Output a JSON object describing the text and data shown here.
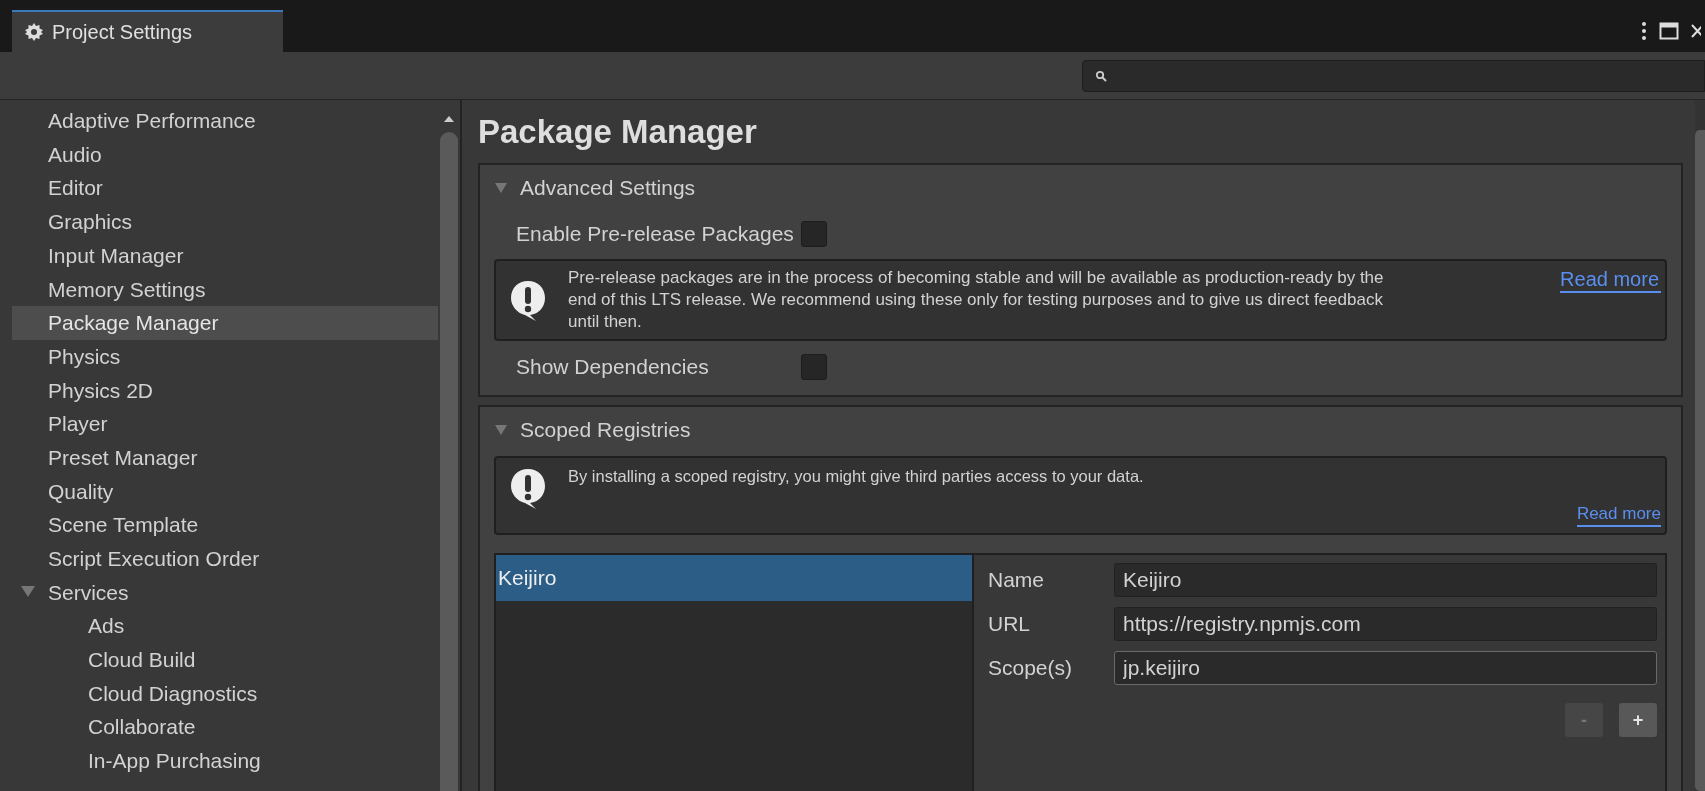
{
  "window": {
    "tab": {
      "title": "Project Settings",
      "selected": true
    }
  },
  "sidebar": {
    "items": [
      {
        "label": "Adaptive Performance",
        "selected": false
      },
      {
        "label": "Audio",
        "selected": false
      },
      {
        "label": "Editor",
        "selected": false
      },
      {
        "label": "Graphics",
        "selected": false
      },
      {
        "label": "Input Manager",
        "selected": false
      },
      {
        "label": "Memory Settings",
        "selected": false
      },
      {
        "label": "Package Manager",
        "selected": true
      },
      {
        "label": "Physics",
        "selected": false
      },
      {
        "label": "Physics 2D",
        "selected": false
      },
      {
        "label": "Player",
        "selected": false
      },
      {
        "label": "Preset Manager",
        "selected": false
      },
      {
        "label": "Quality",
        "selected": false
      },
      {
        "label": "Scene Template",
        "selected": false
      },
      {
        "label": "Script Execution Order",
        "selected": false
      },
      {
        "label": "Services",
        "selected": false,
        "expanded": true,
        "children": [
          {
            "label": "Ads",
            "selected": false
          },
          {
            "label": "Cloud Build",
            "selected": false
          },
          {
            "label": "Cloud Diagnostics",
            "selected": false
          },
          {
            "label": "Collaborate",
            "selected": false
          },
          {
            "label": "In-App Purchasing",
            "selected": false
          }
        ]
      }
    ]
  },
  "content": {
    "title": "Package Manager",
    "sections": [
      {
        "title": "Advanced Settings",
        "expanded": true,
        "rows": [
          {
            "kind": "checkbox",
            "label": "Enable Pre-release Packages",
            "checked": false
          },
          {
            "kind": "help",
            "text": "Pre-release packages are in the process of becoming stable and will be available as production-ready by the end of this LTS release. We recommend using these only for testing purposes and to give us direct feedback until then.",
            "link": "Read more"
          },
          {
            "kind": "checkbox",
            "label": "Show Dependencies",
            "checked": false
          }
        ]
      },
      {
        "title": "Scoped Registries",
        "expanded": true,
        "rows": [
          {
            "kind": "notice",
            "text": "By installing a scoped registry, you might give third parties access to your data.",
            "link": "Read more"
          },
          {
            "kind": "registries",
            "list": [
              {
                "label": "Keijiro",
                "selected": true
              }
            ],
            "fields": [
              {
                "label": "Name",
                "value": "Keijiro",
                "focused": false
              },
              {
                "label": "URL",
                "value": "https://registry.npmjs.com",
                "focused": false
              },
              {
                "label": "Scope(s)",
                "value": "jp.keijiro",
                "focused": true
              }
            ],
            "buttons": [
              {
                "label": "-",
                "disabled": true
              },
              {
                "label": "+",
                "disabled": false
              }
            ]
          }
        ]
      }
    ]
  }
}
